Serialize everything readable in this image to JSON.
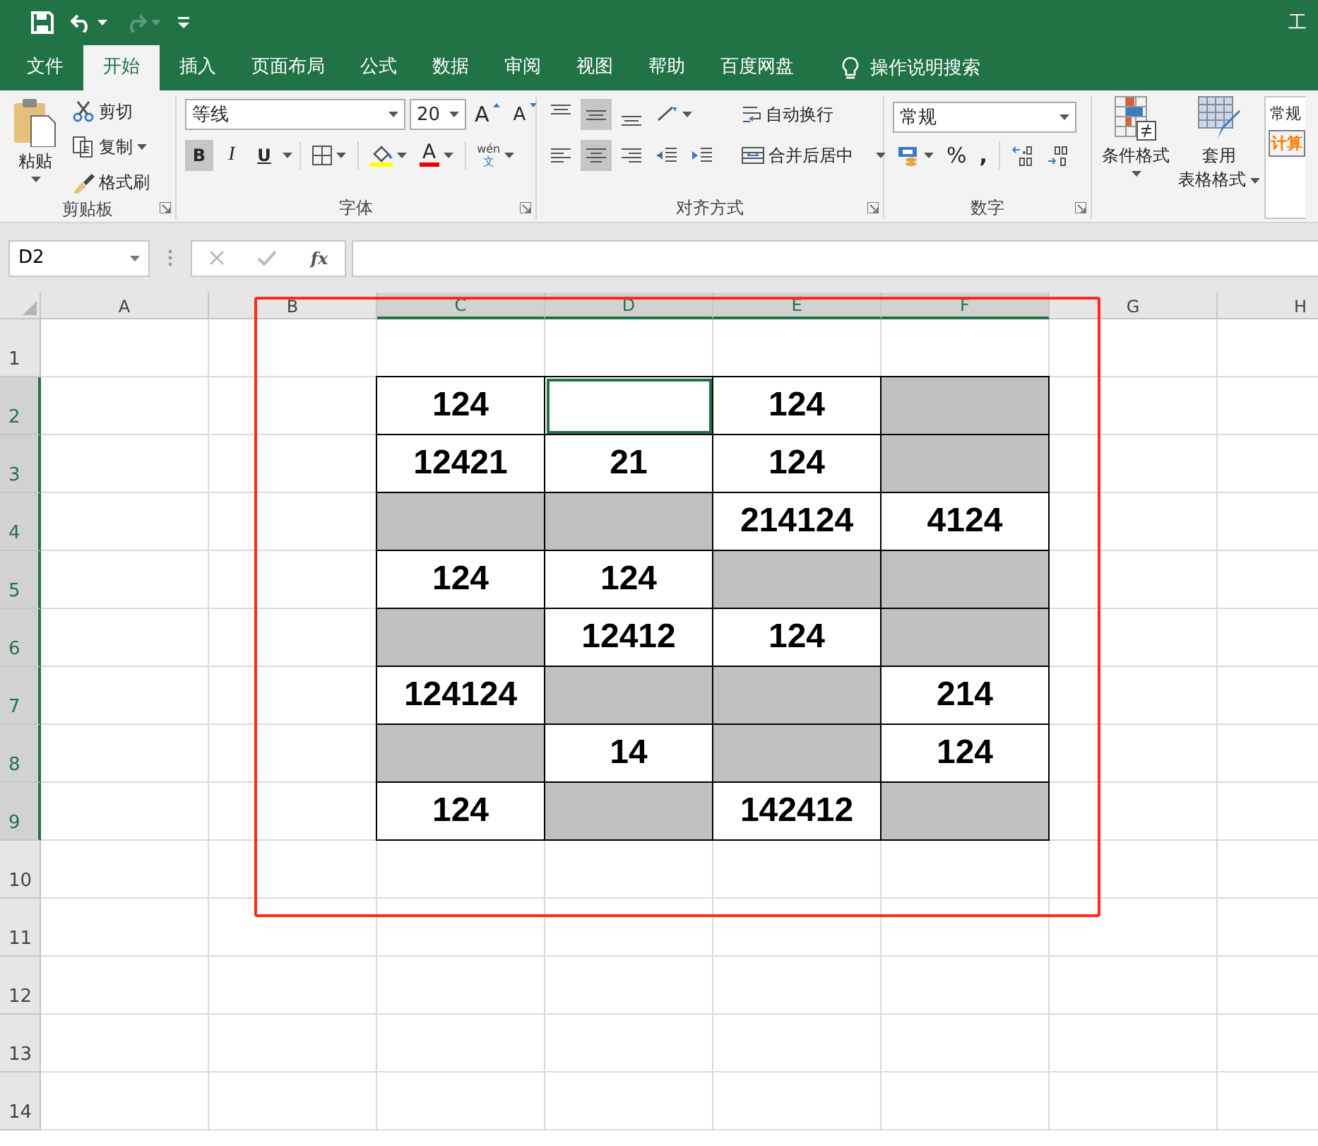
{
  "window": {
    "title": "工"
  },
  "tabs": [
    {
      "label": "文件",
      "selected": false
    },
    {
      "label": "开始",
      "selected": true
    },
    {
      "label": "插入",
      "selected": false
    },
    {
      "label": "页面布局",
      "selected": false
    },
    {
      "label": "公式",
      "selected": false
    },
    {
      "label": "数据",
      "selected": false
    },
    {
      "label": "审阅",
      "selected": false
    },
    {
      "label": "视图",
      "selected": false
    },
    {
      "label": "帮助",
      "selected": false
    },
    {
      "label": "百度网盘",
      "selected": false
    }
  ],
  "tell_me": {
    "placeholder": "操作说明搜索"
  },
  "ribbon": {
    "clipboard": {
      "label": "剪贴板",
      "paste": "粘贴",
      "cut": "剪切",
      "copy": "复制",
      "format_painter": "格式刷"
    },
    "font": {
      "label": "字体",
      "font_name": "等线",
      "font_size": "20",
      "grow_font": "A",
      "shrink_font": "A",
      "font_color": "A",
      "phonetic": [
        "wén",
        "文"
      ],
      "styles": [
        {
          "label": "B",
          "selected": true
        },
        {
          "label": "I",
          "selected": false
        },
        {
          "label": "U",
          "selected": false
        }
      ]
    },
    "alignment": {
      "label": "对齐方式",
      "wrap_text": "自动换行",
      "merge_center": "合并后居中",
      "vertical": [
        {
          "kind": "top",
          "selected": false
        },
        {
          "kind": "middle",
          "selected": true
        },
        {
          "kind": "bottom",
          "selected": false
        }
      ],
      "horizontal": [
        {
          "kind": "left",
          "selected": false
        },
        {
          "kind": "center",
          "selected": true
        },
        {
          "kind": "right",
          "selected": false
        }
      ]
    },
    "number": {
      "label": "数字",
      "format": "常规",
      "percent": "%",
      "comma": ","
    },
    "styles": {
      "conditional_formatting": "条件格式",
      "format_as_table": [
        "套用",
        "表格格式"
      ],
      "cell_styles": [
        "常规",
        "计算"
      ]
    }
  },
  "formula_bar": {
    "name_box": "D2",
    "function_label": "fx"
  },
  "sheet": {
    "columns": [
      {
        "label": "A",
        "highlighted": false
      },
      {
        "label": "B",
        "highlighted": false
      },
      {
        "label": "C",
        "highlighted": true
      },
      {
        "label": "D",
        "highlighted": true
      },
      {
        "label": "E",
        "highlighted": true
      },
      {
        "label": "F",
        "highlighted": true
      },
      {
        "label": "G",
        "highlighted": false
      },
      {
        "label": "H",
        "highlighted": false
      }
    ],
    "rows": [
      {
        "label": "1",
        "highlighted": false
      },
      {
        "label": "2",
        "highlighted": true,
        "cells": [
          {
            "text": "124",
            "shaded": false,
            "selected": false
          },
          {
            "shaded": false,
            "selected": true
          },
          {
            "text": "124",
            "shaded": false,
            "selected": false
          },
          {
            "shaded": true,
            "selected": false
          }
        ]
      },
      {
        "label": "3",
        "highlighted": true,
        "cells": [
          {
            "text": "12421",
            "shaded": false,
            "selected": false
          },
          {
            "text": "21",
            "shaded": false,
            "selected": false
          },
          {
            "text": "124",
            "shaded": false,
            "selected": false
          },
          {
            "shaded": true,
            "selected": false
          }
        ]
      },
      {
        "label": "4",
        "highlighted": true,
        "cells": [
          {
            "shaded": true,
            "selected": false
          },
          {
            "shaded": true,
            "selected": false
          },
          {
            "text": "214124",
            "shaded": false,
            "selected": false
          },
          {
            "text": "4124",
            "shaded": false,
            "selected": false
          }
        ]
      },
      {
        "label": "5",
        "highlighted": true,
        "cells": [
          {
            "text": "124",
            "shaded": false,
            "selected": false
          },
          {
            "text": "124",
            "shaded": false,
            "selected": false
          },
          {
            "shaded": true,
            "selected": false
          },
          {
            "shaded": true,
            "selected": false
          }
        ]
      },
      {
        "label": "6",
        "highlighted": true,
        "cells": [
          {
            "shaded": true,
            "selected": false
          },
          {
            "text": "12412",
            "shaded": false,
            "selected": false
          },
          {
            "text": "124",
            "shaded": false,
            "selected": false
          },
          {
            "shaded": true,
            "selected": false
          }
        ]
      },
      {
        "label": "7",
        "highlighted": true,
        "cells": [
          {
            "text": "124124",
            "shaded": false,
            "selected": false
          },
          {
            "shaded": true,
            "selected": false
          },
          {
            "shaded": true,
            "selected": false
          },
          {
            "text": "214",
            "shaded": false,
            "selected": false
          }
        ]
      },
      {
        "label": "8",
        "highlighted": true,
        "cells": [
          {
            "shaded": true,
            "selected": false
          },
          {
            "text": "14",
            "shaded": false,
            "selected": false
          },
          {
            "shaded": true,
            "selected": false
          },
          {
            "text": "124",
            "shaded": false,
            "selected": false
          }
        ]
      },
      {
        "label": "9",
        "highlighted": true,
        "cells": [
          {
            "text": "124",
            "shaded": false,
            "selected": false
          },
          {
            "shaded": true,
            "selected": false
          },
          {
            "text": "142412",
            "shaded": false,
            "selected": false
          },
          {
            "shaded": true,
            "selected": false
          }
        ]
      },
      {
        "label": "10",
        "highlighted": false
      },
      {
        "label": "11",
        "highlighted": false
      },
      {
        "label": "12",
        "highlighted": false
      },
      {
        "label": "13",
        "highlighted": false
      },
      {
        "label": "14",
        "highlighted": false
      }
    ],
    "annotation_box": {
      "visible": true
    }
  }
}
